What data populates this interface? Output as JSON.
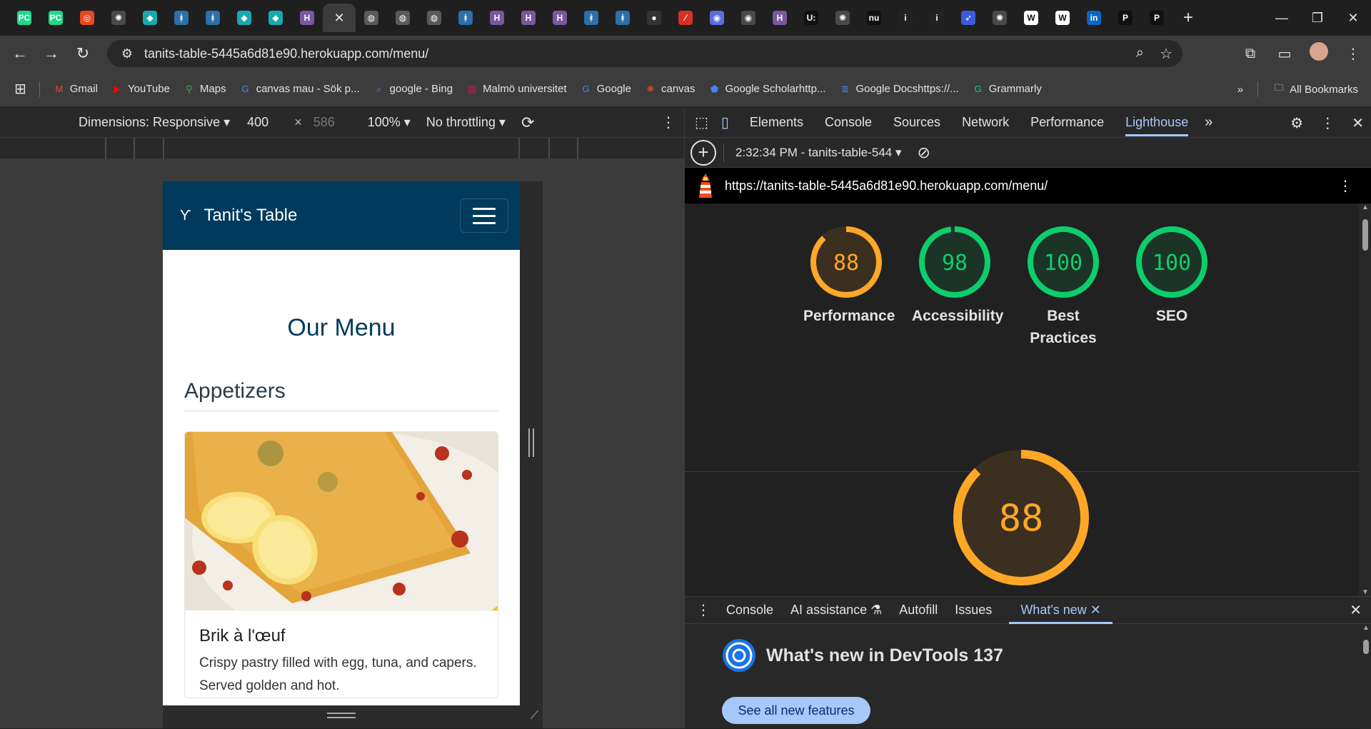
{
  "browser": {
    "url": "tanits-table-5445a6d81e90.herokuapp.com/menu/",
    "tabs": [
      {
        "icon": "pycharm-icon",
        "glyph": "PC",
        "color": "#21d789"
      },
      {
        "icon": "pycharm-icon",
        "glyph": "PC",
        "color": "#21d789"
      },
      {
        "icon": "circle-icon",
        "glyph": "◎",
        "color": "#e8491d"
      },
      {
        "icon": "openai-icon",
        "glyph": "✺",
        "color": "#4a4a4a"
      },
      {
        "icon": "diamond-icon",
        "glyph": "◆",
        "color": "#19a9b0"
      },
      {
        "icon": "cursor-icon",
        "glyph": "ᚼ",
        "color": "#2d6fa8"
      },
      {
        "icon": "cursor-icon",
        "glyph": "ᚼ",
        "color": "#2d6fa8"
      },
      {
        "icon": "diamond-icon",
        "glyph": "◆",
        "color": "#19a9b0"
      },
      {
        "icon": "diamond-icon",
        "glyph": "◆",
        "color": "#19a9b0"
      },
      {
        "icon": "heroku-icon",
        "glyph": "H",
        "color": "#79589f"
      },
      {
        "icon": "close-icon",
        "glyph": "✕",
        "color": "#3c3c3c",
        "active": true
      },
      {
        "icon": "globe-icon",
        "glyph": "◍",
        "color": "#5a5a5a"
      },
      {
        "icon": "globe-icon",
        "glyph": "◍",
        "color": "#5a5a5a"
      },
      {
        "icon": "globe-icon",
        "glyph": "◍",
        "color": "#5a5a5a"
      },
      {
        "icon": "cursor-icon",
        "glyph": "ᚼ",
        "color": "#2d6fa8"
      },
      {
        "icon": "heroku-icon",
        "glyph": "H",
        "color": "#79589f"
      },
      {
        "icon": "heroku-icon",
        "glyph": "H",
        "color": "#79589f"
      },
      {
        "icon": "heroku-icon",
        "glyph": "H",
        "color": "#79589f"
      },
      {
        "icon": "cursor-icon",
        "glyph": "ᚼ",
        "color": "#2d6fa8"
      },
      {
        "icon": "cursor-icon",
        "glyph": "ᚼ",
        "color": "#2d6fa8"
      },
      {
        "icon": "github-icon",
        "glyph": "●",
        "color": "#333"
      },
      {
        "icon": "slash-icon",
        "glyph": "⁄",
        "color": "#d93025"
      },
      {
        "icon": "ring-icon",
        "glyph": "◉",
        "color": "#5b6ee1"
      },
      {
        "icon": "chrome-icon",
        "glyph": "◉",
        "color": "#4a4a4a"
      },
      {
        "icon": "heroku-icon",
        "glyph": "H",
        "color": "#79589f"
      },
      {
        "icon": "ui-icon",
        "glyph": "U:",
        "color": "#111"
      },
      {
        "icon": "openai-icon",
        "glyph": "✺",
        "color": "#4a4a4a"
      },
      {
        "icon": "nu-icon",
        "glyph": "nu",
        "color": "#111"
      },
      {
        "icon": "info-icon",
        "glyph": "i",
        "color": "#222"
      },
      {
        "icon": "info-icon",
        "glyph": "i",
        "color": "#222"
      },
      {
        "icon": "rocket-icon",
        "glyph": "➶",
        "color": "#3b5bdb"
      },
      {
        "icon": "openai-icon",
        "glyph": "✺",
        "color": "#4a4a4a"
      },
      {
        "icon": "w-icon",
        "glyph": "W",
        "color": "#ffffff"
      },
      {
        "icon": "w-icon",
        "glyph": "W",
        "color": "#ffffff"
      },
      {
        "icon": "linkedin-icon",
        "glyph": "in",
        "color": "#0a66c2"
      },
      {
        "icon": "p-icon",
        "glyph": "P",
        "color": "#111"
      },
      {
        "icon": "p-icon",
        "glyph": "P",
        "color": "#111"
      }
    ],
    "bookmarks": [
      {
        "label": "Gmail",
        "icon": "gmail-icon",
        "glyph": "M",
        "color": "#ea4335"
      },
      {
        "label": "YouTube",
        "icon": "youtube-icon",
        "glyph": "▶",
        "color": "#ff0000"
      },
      {
        "label": "Maps",
        "icon": "maps-icon",
        "glyph": "⚲",
        "color": "#34a853"
      },
      {
        "label": "canvas mau - Sök p...",
        "icon": "google-icon",
        "glyph": "G",
        "color": "#4285f4"
      },
      {
        "label": "google - Bing",
        "icon": "search-icon",
        "glyph": "⌕",
        "color": "#5b8def"
      },
      {
        "label": "Malmö universitet",
        "icon": "mau-icon",
        "glyph": "▥",
        "color": "#d4145a"
      },
      {
        "label": "Google",
        "icon": "google-icon",
        "glyph": "G",
        "color": "#4285f4"
      },
      {
        "label": "canvas",
        "icon": "canvas-icon",
        "glyph": "✺",
        "color": "#e2401c"
      },
      {
        "label": "Google Scholarhttp...",
        "icon": "scholar-icon",
        "glyph": "⬟",
        "color": "#4285f4"
      },
      {
        "label": "Google Docshttps://...",
        "icon": "docs-icon",
        "glyph": "≣",
        "color": "#4285f4"
      },
      {
        "label": "Grammarly",
        "icon": "grammarly-icon",
        "glyph": "G",
        "color": "#15c39a"
      }
    ],
    "all_bookmarks": "All Bookmarks"
  },
  "device_toolbar": {
    "dimensions": "Dimensions: Responsive",
    "width": "400",
    "height": "586",
    "zoom": "100%",
    "throttling": "No throttling"
  },
  "site": {
    "brand": "Tanit's Table",
    "logo_glyph": "ϒ",
    "page_title": "Our Menu",
    "section": "Appetizers",
    "dish_name": "Brik à l'œuf",
    "dish_desc": "Crispy pastry filled with egg, tuna, and capers. Served golden and hot."
  },
  "devtools": {
    "tabs": [
      "Elements",
      "Console",
      "Sources",
      "Network",
      "Performance",
      "Lighthouse"
    ],
    "active_tab": "Lighthouse",
    "report_label": "2:32:34 PM - tanits-table-544",
    "report_url": "https://tanits-table-5445a6d81e90.herokuapp.com/menu/",
    "scores": [
      {
        "label": "Performance",
        "value": 88,
        "color": "#ffa726",
        "bg": "#3b2f1f"
      },
      {
        "label": "Accessibility",
        "value": 98,
        "color": "#0cce6b",
        "bg": "#1c3327"
      },
      {
        "label": "Best Practices",
        "value": 100,
        "color": "#0cce6b",
        "bg": "#1c3327"
      },
      {
        "label": "SEO",
        "value": 100,
        "color": "#0cce6b",
        "bg": "#1c3327"
      }
    ],
    "big_score": 88,
    "drawer_tabs": [
      "Console",
      "AI assistance",
      "Autofill",
      "Issues",
      "What's new"
    ],
    "drawer_active": "What's new",
    "whats_new_title": "What's new in DevTools 137",
    "see_all": "See all new features"
  }
}
